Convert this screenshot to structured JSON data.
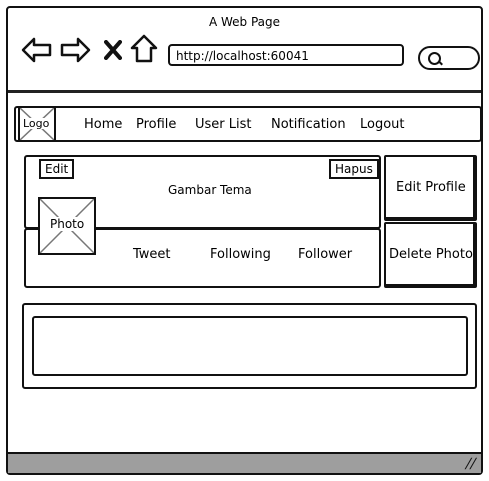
{
  "window": {
    "title": "A Web Page"
  },
  "toolbar": {
    "url": "http://localhost:60041"
  },
  "nav": {
    "logo": "Logo",
    "items": [
      "Home",
      "Profile",
      "User List",
      "Notification",
      "Logout"
    ]
  },
  "profile": {
    "edit_label": "Edit",
    "cover_label": "Gambar Tema",
    "hapus_label": "Hapus",
    "photo_label": "Photo",
    "stats": [
      "Tweet",
      "Following",
      "Follower"
    ],
    "edit_profile_label": "Edit Profile",
    "delete_photo_label": "Delete Photo"
  },
  "statusbar": {
    "grip": "//"
  }
}
